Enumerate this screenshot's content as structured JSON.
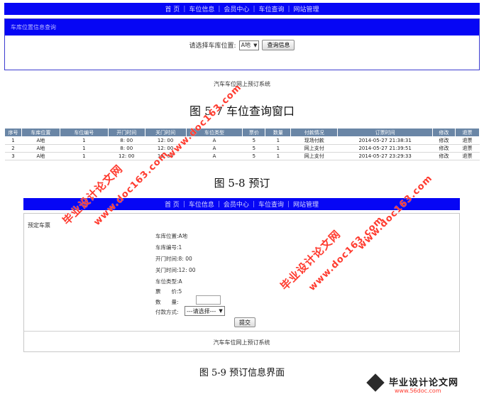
{
  "nav_items": [
    "首 页",
    "车位信息",
    "会员中心",
    "车位查询",
    "网站管理"
  ],
  "figure1": {
    "panel_title": "车库位置信息查询",
    "query_label": "请选择车库位置:",
    "location_value": "A地",
    "query_button": "查询信息",
    "footer": "汽车车位网上预订系统"
  },
  "caption1": "图 5-7 车位查询窗口",
  "figure2": {
    "headers": [
      "序号",
      "车库位置",
      "车位编号",
      "开门时间",
      "关门时间",
      "车位类型",
      "票价",
      "数量",
      "付款情况",
      "订票时间",
      "修改",
      "退票"
    ],
    "rows": [
      [
        "1",
        "A地",
        "1",
        "8: 00",
        "12: 00",
        "A",
        "5",
        "1",
        "现场付款",
        "2014-05-27 21:38:31",
        "修改",
        "退票"
      ],
      [
        "2",
        "A地",
        "1",
        "8: 00",
        "12: 00",
        "A",
        "5",
        "1",
        "网上支付",
        "2014-05-27 21:39:51",
        "修改",
        "退票"
      ],
      [
        "3",
        "A地",
        "1",
        "12: 00",
        "12: 00",
        "A",
        "5",
        "1",
        "网上支付",
        "2014-05-27 23:29:33",
        "修改",
        "退票"
      ]
    ]
  },
  "caption2": "图 5-8 预订",
  "figure3": {
    "title": "预定车票",
    "fields": [
      {
        "label": "车库位置:",
        "value": "A地"
      },
      {
        "label": "车库编号:",
        "value": "1"
      },
      {
        "label": "开门时间:",
        "value": "8: 00"
      },
      {
        "label": "关门时间:",
        "value": "12: 00"
      },
      {
        "label": "车位类型:",
        "value": "A"
      },
      {
        "label": "票　　价:",
        "value": "5"
      }
    ],
    "quantity_label": "数　　量:",
    "payment_label": "付款方式:",
    "payment_value": "---请选择---",
    "submit_button": "提交",
    "footer": "汽车车位网上预订系统"
  },
  "caption3": "图 5-9 预订信息界面",
  "watermarks": {
    "cn": "毕业设计论文网",
    "url": "www.doc163.com"
  },
  "logo": {
    "text": "毕业设计论文网",
    "url": "www.56doc.com"
  },
  "colors": {
    "nav_blue": "#0606f5",
    "table_header": "#6a86a6",
    "watermark_red": "#ff3b2f"
  }
}
